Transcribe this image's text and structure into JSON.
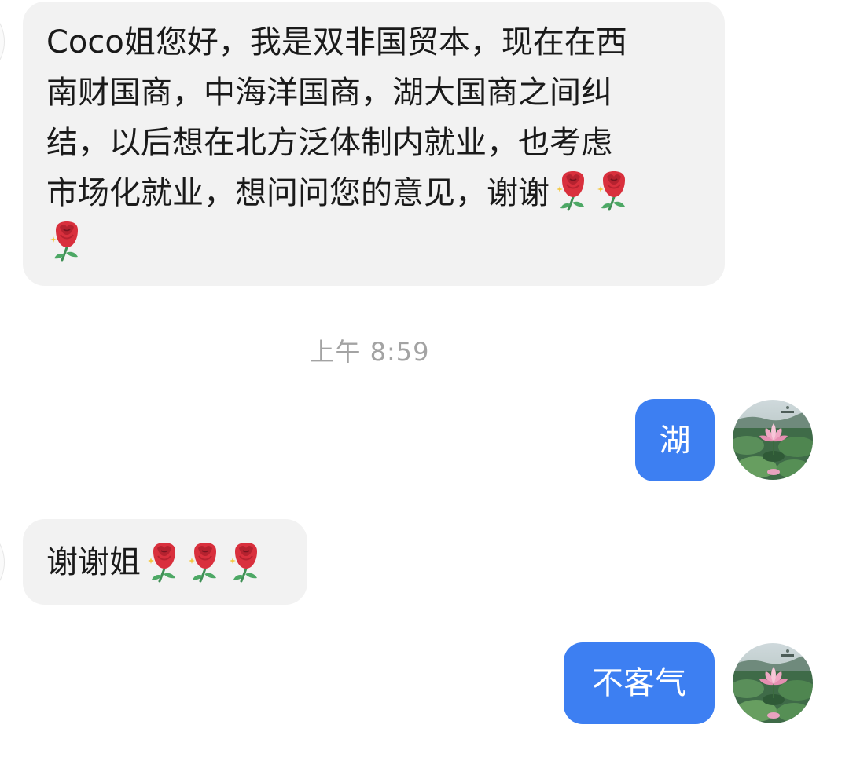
{
  "conversation": {
    "messages": [
      {
        "sender": "other",
        "lines": [
          "Coco姐您好，我是双非国贸本，现在在西",
          "南财国商，中海洋国商，湖大国商之间纠",
          "结，以后想在北方泛体制内就业，也考虑",
          "市场化就业，想问问您的意见，谢谢"
        ],
        "emoji": [
          "rose-emoji",
          "rose-emoji",
          "rose-emoji"
        ]
      },
      {
        "sender": "self",
        "text": "湖"
      },
      {
        "sender": "other",
        "text": "谢谢姐",
        "emoji": [
          "rose-emoji",
          "rose-emoji",
          "rose-emoji"
        ]
      },
      {
        "sender": "self",
        "text": "不客气"
      }
    ],
    "timestamp": "上午 8:59"
  },
  "colors": {
    "incoming_bubble": "#f2f2f2",
    "outgoing_bubble": "#3d7ff2",
    "timestamp_text": "#a3a3a3",
    "rose": "#d9303d"
  },
  "avatar": {
    "icon": "lotus-pond-avatar"
  }
}
